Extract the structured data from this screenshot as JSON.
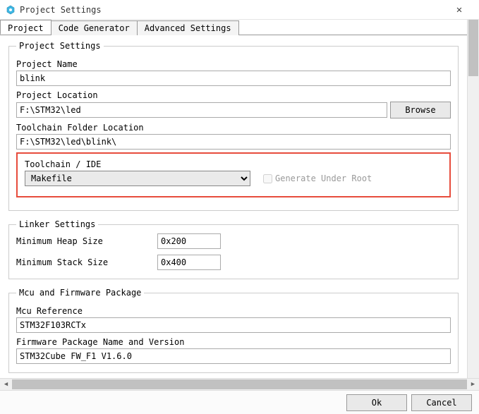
{
  "window": {
    "title": "Project Settings"
  },
  "tabs": [
    {
      "label": "Project",
      "active": true
    },
    {
      "label": "Code Generator",
      "active": false
    },
    {
      "label": "Advanced Settings",
      "active": false
    }
  ],
  "projectSettings": {
    "legend": "Project Settings",
    "projectName": {
      "label": "Project Name",
      "value": "blink"
    },
    "projectLocation": {
      "label": "Project Location",
      "value": "F:\\STM32\\led",
      "browse": "Browse"
    },
    "toolchainFolder": {
      "label": "Toolchain Folder Location",
      "value": "F:\\STM32\\led\\blink\\"
    },
    "toolchainIde": {
      "label": "Toolchain / IDE",
      "value": "Makefile",
      "generateUnderRoot": {
        "label": "Generate Under Root",
        "checked": false
      }
    }
  },
  "linkerSettings": {
    "legend": "Linker Settings",
    "minHeap": {
      "label": "Minimum Heap Size",
      "value": "0x200"
    },
    "minStack": {
      "label": "Minimum Stack Size",
      "value": "0x400"
    }
  },
  "mcuFirmware": {
    "legend": "Mcu and Firmware Package",
    "mcuRef": {
      "label": "Mcu Reference",
      "value": "STM32F103RCTx"
    },
    "fwPackage": {
      "label": "Firmware Package Name and Version",
      "value": "STM32Cube FW_F1 V1.6.0"
    }
  },
  "footer": {
    "ok": "Ok",
    "cancel": "Cancel"
  }
}
